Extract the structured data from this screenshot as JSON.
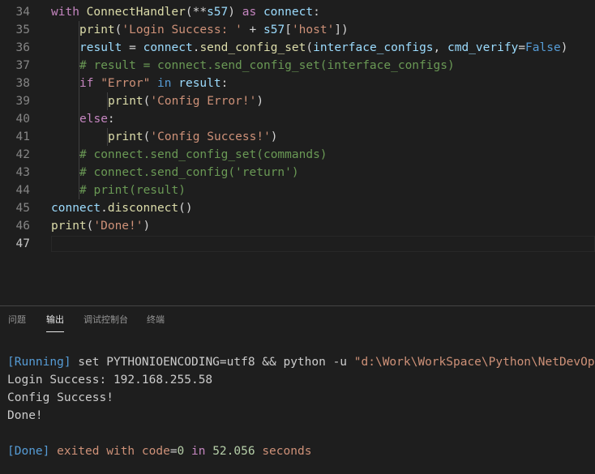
{
  "editor": {
    "lines": [
      {
        "n": "34",
        "tokens": [
          {
            "t": "with ",
            "c": "kw"
          },
          {
            "t": "ConnectHandler",
            "c": "fn"
          },
          {
            "t": "(**",
            "c": "op"
          },
          {
            "t": "s57",
            "c": "var"
          },
          {
            "t": ") ",
            "c": "op"
          },
          {
            "t": "as ",
            "c": "kw"
          },
          {
            "t": "connect",
            "c": "var"
          },
          {
            "t": ":",
            "c": "op"
          }
        ]
      },
      {
        "n": "35",
        "tokens": [
          {
            "t": "print",
            "c": "fn"
          },
          {
            "t": "(",
            "c": "op"
          },
          {
            "t": "'Login Success: '",
            "c": "str"
          },
          {
            "t": " + ",
            "c": "op"
          },
          {
            "t": "s57",
            "c": "var"
          },
          {
            "t": "[",
            "c": "op"
          },
          {
            "t": "'host'",
            "c": "str"
          },
          {
            "t": "])",
            "c": "op"
          }
        ]
      },
      {
        "n": "36",
        "tokens": [
          {
            "t": "result",
            "c": "var"
          },
          {
            "t": " = ",
            "c": "op"
          },
          {
            "t": "connect",
            "c": "var"
          },
          {
            "t": ".",
            "c": "op"
          },
          {
            "t": "send_config_set",
            "c": "fn"
          },
          {
            "t": "(",
            "c": "op"
          },
          {
            "t": "interface_configs",
            "c": "var"
          },
          {
            "t": ", ",
            "c": "op"
          },
          {
            "t": "cmd_verify",
            "c": "var"
          },
          {
            "t": "=",
            "c": "op"
          },
          {
            "t": "False",
            "c": "const"
          },
          {
            "t": ")",
            "c": "op"
          }
        ]
      },
      {
        "n": "37",
        "tokens": [
          {
            "t": "# result = connect.send_config_set(interface_configs)",
            "c": "cm"
          }
        ]
      },
      {
        "n": "38",
        "tokens": [
          {
            "t": "if ",
            "c": "kw"
          },
          {
            "t": "\"Error\"",
            "c": "str"
          },
          {
            "t": " in ",
            "c": "const"
          },
          {
            "t": "result",
            "c": "var"
          },
          {
            "t": ":",
            "c": "op"
          }
        ]
      },
      {
        "n": "39",
        "tokens": [
          {
            "t": "print",
            "c": "fn"
          },
          {
            "t": "(",
            "c": "op"
          },
          {
            "t": "'Config Error!'",
            "c": "str"
          },
          {
            "t": ")",
            "c": "op"
          }
        ]
      },
      {
        "n": "40",
        "tokens": [
          {
            "t": "else",
            "c": "kw"
          },
          {
            "t": ":",
            "c": "op"
          }
        ]
      },
      {
        "n": "41",
        "tokens": [
          {
            "t": "print",
            "c": "fn"
          },
          {
            "t": "(",
            "c": "op"
          },
          {
            "t": "'Config Success!'",
            "c": "str"
          },
          {
            "t": ")",
            "c": "op"
          }
        ]
      },
      {
        "n": "42",
        "tokens": [
          {
            "t": "# connect.send_config_set(commands)",
            "c": "cm"
          }
        ]
      },
      {
        "n": "43",
        "tokens": [
          {
            "t": "# connect.send_config('return')",
            "c": "cm"
          }
        ]
      },
      {
        "n": "44",
        "tokens": [
          {
            "t": "# print(result)",
            "c": "cm"
          }
        ]
      },
      {
        "n": "45",
        "tokens": [
          {
            "t": "connect",
            "c": "var"
          },
          {
            "t": ".",
            "c": "op"
          },
          {
            "t": "disconnect",
            "c": "fn"
          },
          {
            "t": "()",
            "c": "op"
          }
        ]
      },
      {
        "n": "46",
        "tokens": [
          {
            "t": "print",
            "c": "fn"
          },
          {
            "t": "(",
            "c": "op"
          },
          {
            "t": "'Done!'",
            "c": "str"
          },
          {
            "t": ")",
            "c": "op"
          }
        ]
      },
      {
        "n": "47",
        "tokens": []
      }
    ]
  },
  "panel": {
    "tabs": [
      {
        "label": "问题"
      },
      {
        "label": "输出"
      },
      {
        "label": "调试控制台"
      },
      {
        "label": "终端"
      }
    ],
    "output": [
      {
        "segments": [
          {
            "t": "[Running]",
            "c": "tag"
          },
          {
            "t": " set PYTHONIOENCODING=utf8 && python -u ",
            "c": "plain"
          },
          {
            "t": "\"d:\\Work\\WorkSpace\\Python\\NetDevOps",
            "c": "str"
          }
        ]
      },
      {
        "segments": [
          {
            "t": "Login Success: 192.168.255.58",
            "c": "plain"
          }
        ]
      },
      {
        "segments": [
          {
            "t": "Config Success!",
            "c": "plain"
          }
        ]
      },
      {
        "segments": [
          {
            "t": "Done!",
            "c": "plain"
          }
        ]
      },
      {
        "segments": []
      },
      {
        "segments": [
          {
            "t": "[Done]",
            "c": "tag"
          },
          {
            "t": " exited with ",
            "c": "str"
          },
          {
            "t": "code",
            "c": "str"
          },
          {
            "t": "=",
            "c": "plain"
          },
          {
            "t": "0",
            "c": "num"
          },
          {
            "t": " in ",
            "c": "kw"
          },
          {
            "t": "52.056",
            "c": "num"
          },
          {
            "t": " seconds",
            "c": "str"
          }
        ]
      }
    ]
  }
}
